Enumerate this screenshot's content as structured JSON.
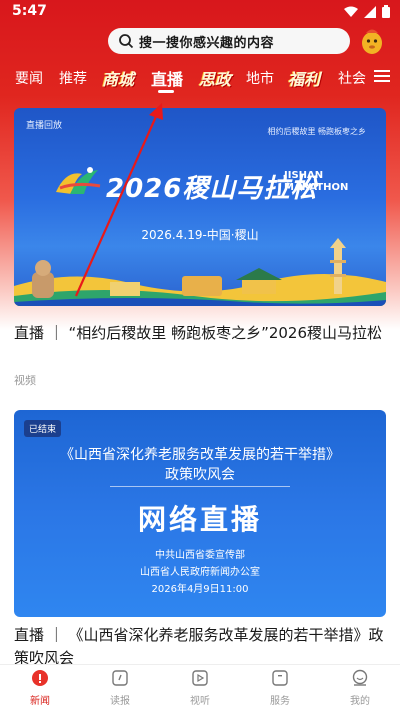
{
  "status_bar": {
    "time": "5:47"
  },
  "search": {
    "placeholder": "搜一搜你感兴趣的内容"
  },
  "tabs": [
    {
      "label": "要闻"
    },
    {
      "label": "推荐"
    },
    {
      "label": "商城"
    },
    {
      "label": "直播",
      "active": true
    },
    {
      "label": "思政"
    },
    {
      "label": "地市"
    },
    {
      "label": "福利"
    },
    {
      "label": "社会"
    }
  ],
  "card1": {
    "badge": "直播回放",
    "tagline": "相约后稷故里 畅跑板枣之乡",
    "title": "2026稷山马拉松",
    "title_en_1": "JISHAN",
    "title_en_2": "MARATHON",
    "date": "2026.4.19-中国·稷山",
    "headline": "直播 ｜ “相约后稷故里 畅跑板枣之乡”2026稷山马拉松",
    "meta": "视频"
  },
  "card2": {
    "badge": "已结束",
    "title_line1": "《山西省深化养老服务改革发展的若干举措》",
    "title_line2": "政策吹风会",
    "big_title": "网络直播",
    "org1": "中共山西省委宣传部",
    "org2": "山西省人民政府新闻办公室",
    "datetime": "2026年4月9日11:00",
    "headline": "直播 ｜ 《山西省深化养老服务改革发展的若干举措》政策吹风会"
  },
  "bottom_nav": [
    {
      "label": "新闻",
      "active": true
    },
    {
      "label": "读报"
    },
    {
      "label": "视听"
    },
    {
      "label": "服务"
    },
    {
      "label": "我的"
    }
  ],
  "colors": {
    "brand_red": "#d9221c",
    "card_blue": "#2a6de0"
  }
}
